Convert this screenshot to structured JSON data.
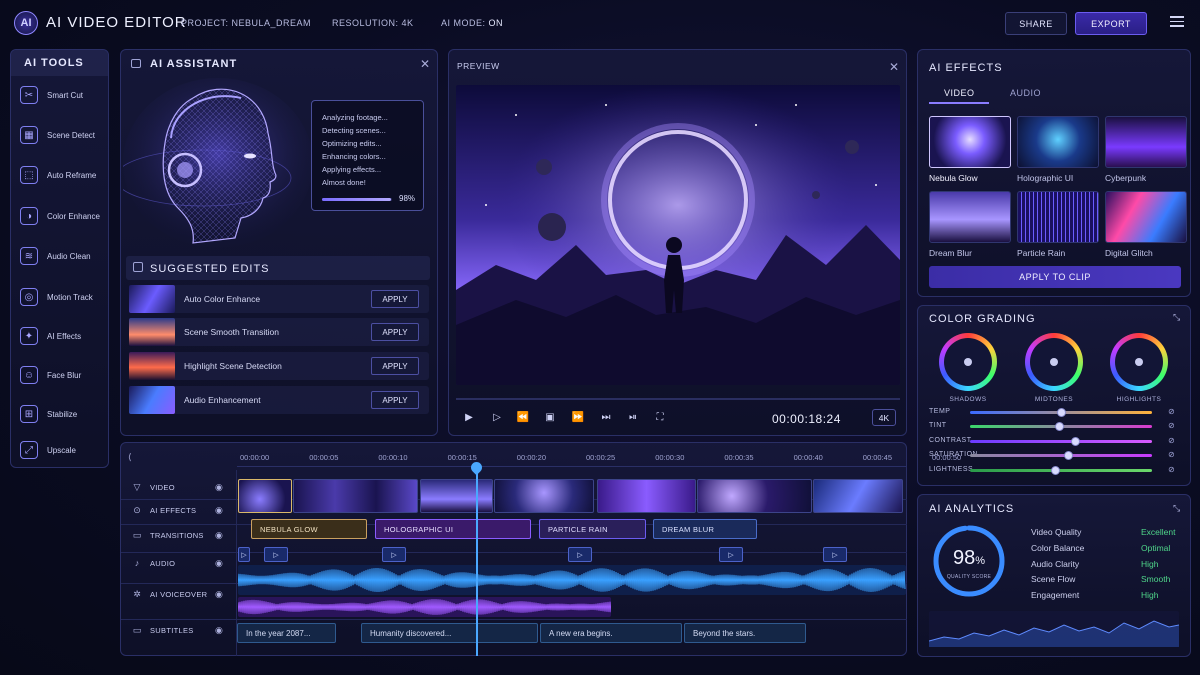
{
  "header": {
    "logo_text": "AI",
    "title": "AI VIDEO EDITOR",
    "project": "PROJECT: NEBULA_DREAM",
    "resolution": "RESOLUTION: 4K",
    "ai_mode_label": "AI MODE:",
    "ai_mode_value": "ON",
    "share_label": "SHARE",
    "export_label": "EXPORT"
  },
  "tools": {
    "title": "AI TOOLS",
    "items": [
      {
        "label": "Smart Cut",
        "icon": "scissors-icon",
        "glyph": "✂"
      },
      {
        "label": "Scene Detect",
        "icon": "scene-detect-icon",
        "glyph": "▦"
      },
      {
        "label": "Auto Reframe",
        "icon": "reframe-icon",
        "glyph": "⬚"
      },
      {
        "label": "Color Enhance",
        "icon": "color-icon",
        "glyph": "◑"
      },
      {
        "label": "Audio Clean",
        "icon": "audio-wave-icon",
        "glyph": "≋"
      },
      {
        "label": "Motion Track",
        "icon": "motion-track-icon",
        "glyph": "◎"
      },
      {
        "label": "AI Effects",
        "icon": "sparkle-icon",
        "glyph": "✦"
      },
      {
        "label": "Face Blur",
        "icon": "face-icon",
        "glyph": "☺"
      },
      {
        "label": "Stabilize",
        "icon": "stabilize-icon",
        "glyph": "⊞"
      },
      {
        "label": "Upscale",
        "icon": "upscale-icon",
        "glyph": "⤢"
      }
    ]
  },
  "assistant": {
    "title": "AI ASSISTANT",
    "analysis_lines": [
      "Analyzing footage...",
      "Detecting scenes...",
      "Optimizing edits...",
      "Enhancing colors...",
      "Applying effects...",
      "Almost done!"
    ],
    "progress": 0.98,
    "progress_label": "98%",
    "suggested_title": "SUGGESTED EDITS",
    "suggestions": [
      {
        "label": "Auto Color Enhance",
        "apply": "APPLY"
      },
      {
        "label": "Scene Smooth Transition",
        "apply": "APPLY"
      },
      {
        "label": "Highlight Scene Detection",
        "apply": "APPLY"
      },
      {
        "label": "Audio Enhancement",
        "apply": "APPLY"
      }
    ]
  },
  "preview": {
    "title": "PREVIEW",
    "timecode": "00:00:18:24",
    "quality_badge": "4K"
  },
  "effects": {
    "title": "AI EFFECTS",
    "tabs": [
      "VIDEO",
      "AUDIO"
    ],
    "active_tab": "VIDEO",
    "items": [
      "Nebula Glow",
      "Holographic UI",
      "Cyberpunk",
      "Dream Blur",
      "Particle Rain",
      "Digital Glitch"
    ],
    "selected": "Nebula Glow",
    "apply_label": "APPLY TO CLIP"
  },
  "grading": {
    "title": "COLOR GRADING",
    "wheels": [
      "SHADOWS",
      "MIDTONES",
      "HIGHLIGHTS"
    ],
    "sliders": [
      {
        "label": "TEMP",
        "value": 0.5,
        "colors": [
          "#3b6bff",
          "#ffb23b"
        ]
      },
      {
        "label": "TINT",
        "value": 0.49,
        "colors": [
          "#3bd86b",
          "#d83bd0"
        ]
      },
      {
        "label": "CONTRAST",
        "value": 0.58,
        "colors": [
          "#6b3bff",
          "#d85bff"
        ]
      },
      {
        "label": "SATURATION",
        "value": 0.54,
        "colors": [
          "#8a8aa0",
          "#c83bff"
        ]
      },
      {
        "label": "LIGHTNESS",
        "value": 0.47,
        "colors": [
          "#2a9a4a",
          "#6bd86b"
        ]
      }
    ]
  },
  "analytics": {
    "title": "AI ANALYTICS",
    "score": 0.98,
    "score_label_number": "98",
    "score_unit": "%",
    "score_caption": "QUALITY SCORE",
    "metrics": [
      {
        "label": "Video Quality",
        "value": "Excellent"
      },
      {
        "label": "Color Balance",
        "value": "Optimal"
      },
      {
        "label": "Audio Clarity",
        "value": "High"
      },
      {
        "label": "Scene Flow",
        "value": "Smooth"
      },
      {
        "label": "Engagement",
        "value": "High"
      }
    ]
  },
  "timeline": {
    "ticks": [
      "00:00:00",
      "00:00:05",
      "00:00:10",
      "00:00:15",
      "00:00:20",
      "00:00:25",
      "00:00:30",
      "00:00:35",
      "00:00:40",
      "00:00:45",
      "00:00:50"
    ],
    "tracks": [
      "VIDEO",
      "AI EFFECTS",
      "TRANSITIONS",
      "AUDIO",
      "AI VOICEOVER",
      "SUBTITLES"
    ],
    "effect_clips": [
      "NEBULA GLOW",
      "HOLOGRAPHIC UI",
      "PARTICLE RAIN",
      "DREAM BLUR"
    ],
    "subtitles": [
      "In the year 2087...",
      "Humanity discovered...",
      "A new era begins.",
      "Beyond the stars."
    ]
  },
  "colors": {
    "accent": "#6b5cf0",
    "success": "#4fd68a",
    "playhead": "#4aa8ff"
  }
}
